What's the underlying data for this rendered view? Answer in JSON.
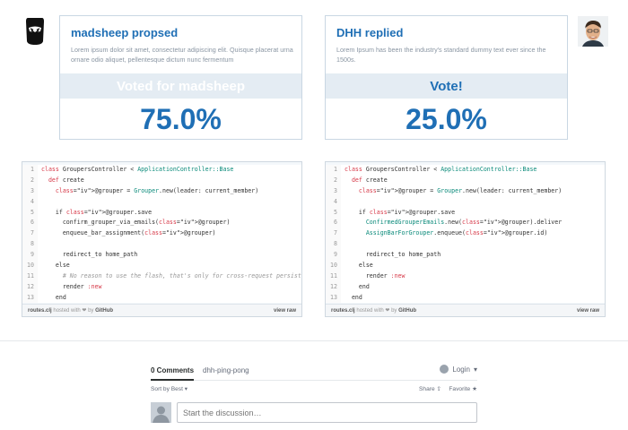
{
  "left_proposal": {
    "title": "madsheep propsed",
    "description": "Lorem ipsum dolor sit amet, consectetur adipiscing elit. Quisque placerat urna ornare odio aliquet, pellentesque dictum nunc fermentum",
    "vote_label": "Voted for madsheep",
    "percentage": "75.0%"
  },
  "right_proposal": {
    "title": "DHH replied",
    "description": "Lorem Ipsum has been the industry's standard dummy text ever since the 1500s.",
    "vote_label": "Vote!",
    "percentage": "25.0%"
  },
  "gist_footer": {
    "filename": "routes.clj",
    "hosted_text": "hosted with ❤ by",
    "github": "GitHub",
    "view_raw": "view raw"
  },
  "left_code": [
    {
      "n": "1",
      "t": "class GroupersController < ApplicationController::Base"
    },
    {
      "n": "2",
      "t": "  def create"
    },
    {
      "n": "3",
      "t": "    @grouper = Grouper.new(leader: current_member)"
    },
    {
      "n": "4",
      "t": ""
    },
    {
      "n": "5",
      "t": "    if @grouper.save"
    },
    {
      "n": "6",
      "t": "      confirm_grouper_via_emails(@grouper)"
    },
    {
      "n": "7",
      "t": "      enqueue_bar_assignment(@grouper)"
    },
    {
      "n": "8",
      "t": ""
    },
    {
      "n": "9",
      "t": "      redirect_to home_path"
    },
    {
      "n": "10",
      "t": "    else"
    },
    {
      "n": "11",
      "t": "      # No reason to use the flash, that's only for cross-request persisten"
    },
    {
      "n": "12",
      "t": "      render :new"
    },
    {
      "n": "13",
      "t": "    end"
    }
  ],
  "right_code": [
    {
      "n": "1",
      "t": "class GroupersController < ApplicationController::Base"
    },
    {
      "n": "2",
      "t": "  def create"
    },
    {
      "n": "3",
      "t": "    @grouper = Grouper.new(leader: current_member)"
    },
    {
      "n": "4",
      "t": ""
    },
    {
      "n": "5",
      "t": "    if @grouper.save"
    },
    {
      "n": "6",
      "t": "      ConfirmedGrouperEmails.new(@grouper).deliver"
    },
    {
      "n": "7",
      "t": "      AssignBarForGrouper.enqueue(@grouper.id)"
    },
    {
      "n": "8",
      "t": ""
    },
    {
      "n": "9",
      "t": "      redirect_to home_path"
    },
    {
      "n": "10",
      "t": "    else"
    },
    {
      "n": "11",
      "t": "      render :new"
    },
    {
      "n": "12",
      "t": "    end"
    },
    {
      "n": "13",
      "t": "  end"
    }
  ],
  "comments": {
    "count_tab": "0 Comments",
    "community_tab": "dhh-ping-pong",
    "login": "Login",
    "sort": "Sort by Best",
    "share": "Share",
    "favorite": "Favorite",
    "placeholder": "Start the discussion…"
  },
  "colors": {
    "accent": "#1f6fb5",
    "band": "#e4ecf3"
  }
}
